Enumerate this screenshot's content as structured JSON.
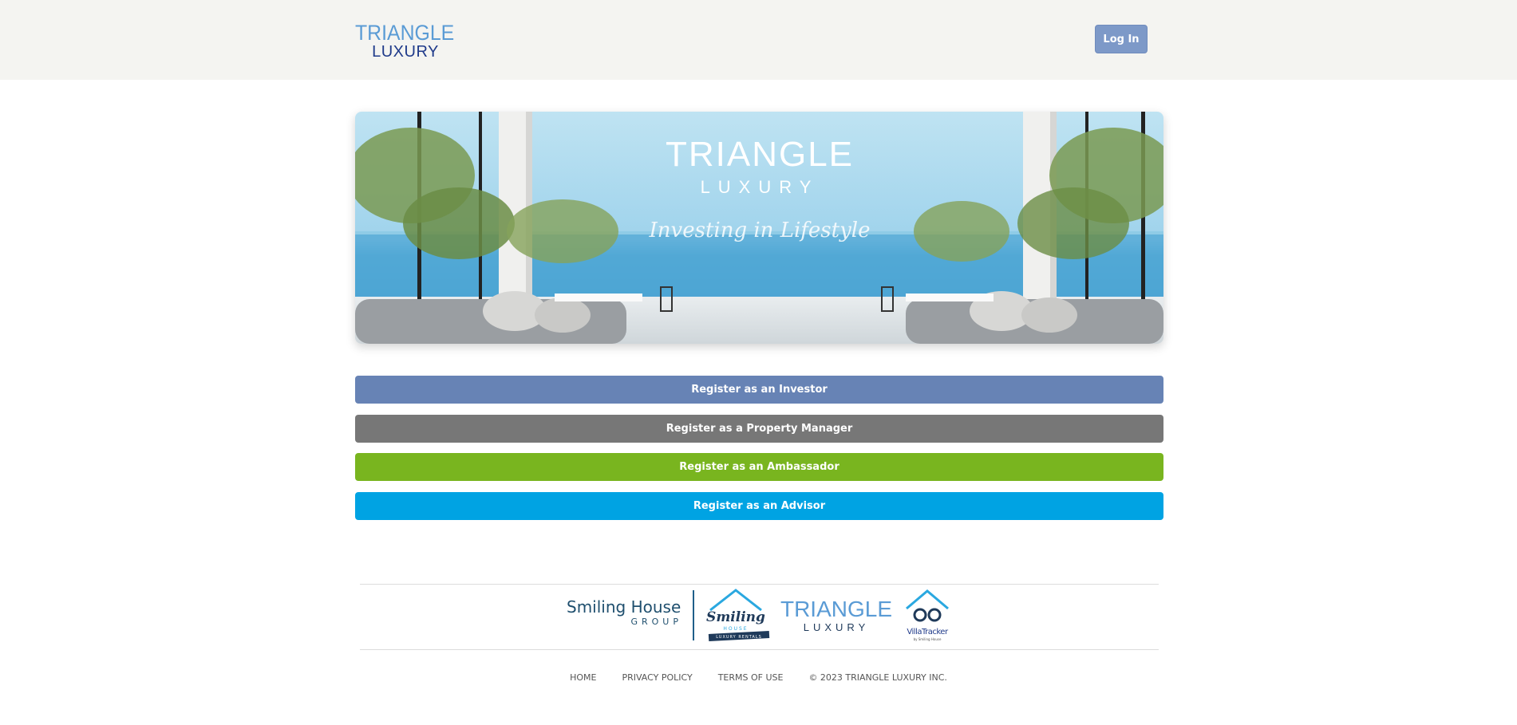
{
  "header": {
    "logo_line1": "TRIANGLE",
    "logo_line2": "LUXURY",
    "login_label": "Log In"
  },
  "hero": {
    "brand_line1": "TRIANGLE",
    "brand_line2": "LUXURY",
    "tagline": "Investing in Lifestyle"
  },
  "register_buttons": [
    {
      "label": "Register as an Investor",
      "color": "#6783b5"
    },
    {
      "label": "Register as a Property Manager",
      "color": "#777777"
    },
    {
      "label": "Register as an Ambassador",
      "color": "#79b51f"
    },
    {
      "label": "Register as an Advisor",
      "color": "#00a3e3"
    }
  ],
  "partners": {
    "smiling_house_group_line1": "Smiling House",
    "smiling_house_group_line2": "GROUP",
    "smiling_house_word": "Smiling",
    "smiling_house_sub": "HOUSE",
    "smiling_house_ribbon": "LUXURY RENTALS",
    "triangle_line1": "TRIANGLE",
    "triangle_line2": "LUXURY",
    "villatracker_name": "VillaTracker",
    "villatracker_sub": "by Smiling House"
  },
  "footer": {
    "home": "HOME",
    "privacy": "PRIVACY POLICY",
    "terms": "TERMS OF USE",
    "copyright": "© 2023 TRIANGLE LUXURY INC."
  },
  "colors": {
    "header_bg": "#f4f4f1",
    "login_bg": "#7d99c8",
    "brand_blue": "#1f3a8a",
    "brand_light_blue": "#5a9bd5"
  }
}
